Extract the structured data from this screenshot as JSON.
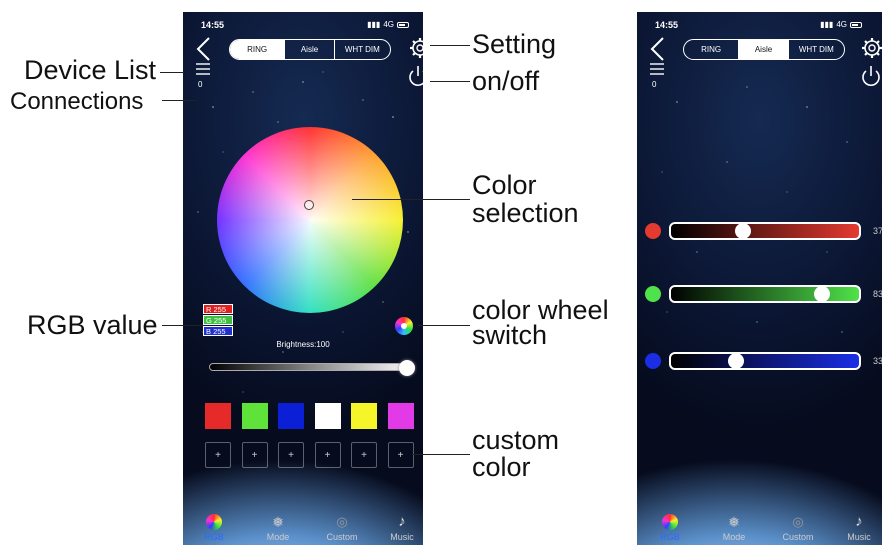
{
  "callouts": {
    "device_list": "Device List",
    "connections": "Connections",
    "rgb_value": "RGB value",
    "setting": "Setting",
    "on_off": "on/off",
    "color_selection_1": "Color",
    "color_selection_2": "selection",
    "color_wheel_switch_1": "color wheel",
    "color_wheel_switch_2": "switch",
    "custom_color_1": "custom",
    "custom_color_2": "color"
  },
  "left_phone": {
    "status_time": "14:55",
    "status_network": "4G",
    "tabs": [
      {
        "label": "RING",
        "active": true
      },
      {
        "label": "Aisle",
        "active": false
      },
      {
        "label": "WHT DIM",
        "active": false
      }
    ],
    "connection_count": "0",
    "rgb": {
      "r": "R 255",
      "g": "G 255",
      "b": "B 255"
    },
    "brightness_label": "Brightness:100",
    "brightness_value": 100,
    "swatches": [
      "#e62a2a",
      "#5fe33a",
      "#0a1fd6",
      "#ffffff",
      "#f5f52a",
      "#e23ae6"
    ],
    "custom_slots": [
      "+",
      "+",
      "+",
      "+",
      "+",
      "+"
    ],
    "nav": [
      {
        "label": "RGB",
        "active": true,
        "icon": "color-palette-icon"
      },
      {
        "label": "Mode",
        "active": false,
        "icon": "mode-icon"
      },
      {
        "label": "Custom",
        "active": false,
        "icon": "custom-icon"
      },
      {
        "label": "Music",
        "active": false,
        "icon": "music-note-icon"
      }
    ]
  },
  "right_phone": {
    "status_time": "14:55",
    "status_network": "4G",
    "tabs": [
      {
        "label": "RING",
        "active": false
      },
      {
        "label": "Aisle",
        "active": true
      },
      {
        "label": "WHT DIM",
        "active": false
      }
    ],
    "connection_count": "0",
    "channels": [
      {
        "name": "red",
        "color": "#e53a30",
        "value_text": "37",
        "level": 0.37
      },
      {
        "name": "green",
        "color": "#4fe24a",
        "value_text": "83",
        "level": 0.83
      },
      {
        "name": "blue",
        "color": "#1b2ee6",
        "value_text": "33",
        "level": 0.33
      }
    ],
    "nav": [
      {
        "label": "RGB",
        "active": true,
        "icon": "color-palette-icon"
      },
      {
        "label": "Mode",
        "active": false,
        "icon": "mode-icon"
      },
      {
        "label": "Custom",
        "active": false,
        "icon": "custom-icon"
      },
      {
        "label": "Music",
        "active": false,
        "icon": "music-note-icon"
      }
    ]
  }
}
